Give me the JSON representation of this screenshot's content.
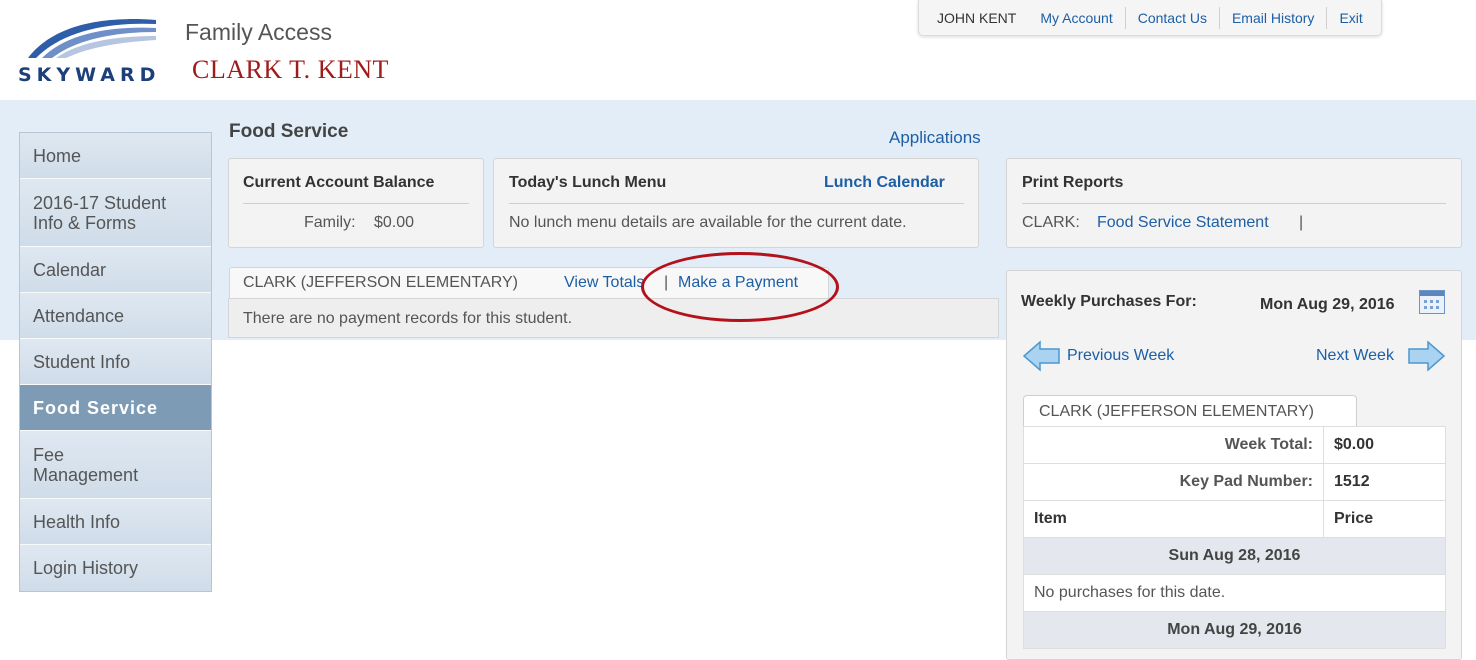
{
  "header": {
    "logo_text": "SKYWARD",
    "product": "Family Access",
    "student_name": "CLARK T. KENT"
  },
  "topnav": {
    "user": "JOHN KENT",
    "my_account": "My Account",
    "contact_us": "Contact Us",
    "email_history": "Email History",
    "exit": "Exit"
  },
  "sidebar": {
    "items": [
      {
        "label": "Home"
      },
      {
        "label": "2016-17 Student Info & Forms"
      },
      {
        "label": "Calendar"
      },
      {
        "label": "Attendance"
      },
      {
        "label": "Student Info"
      },
      {
        "label": "Food Service"
      },
      {
        "label": "Fee Management"
      },
      {
        "label": "Health Info"
      },
      {
        "label": "Login History"
      }
    ]
  },
  "main": {
    "title": "Food Service",
    "applications_link": "Applications",
    "balance": {
      "title": "Current Account Balance",
      "family_label": "Family:",
      "family_value": "$0.00"
    },
    "lunch": {
      "title": "Today's Lunch Menu",
      "calendar_link": "Lunch Calendar",
      "message": "No lunch menu details are available for the current date."
    },
    "reports": {
      "title": "Print Reports",
      "student": "CLARK:",
      "statement_link": "Food Service Statement",
      "separator": "|"
    },
    "student_tab": {
      "label": "CLARK (JEFFERSON ELEMENTARY)",
      "view_totals": "View Totals",
      "separator": "|",
      "make_payment": "Make a Payment",
      "message": "There are no payment records for this student."
    }
  },
  "weekly": {
    "label": "Weekly Purchases For:",
    "date": "Mon Aug 29, 2016",
    "prev": "Previous Week",
    "next": "Next Week",
    "tab": "CLARK (JEFFERSON ELEMENTARY)",
    "week_total_label": "Week Total:",
    "week_total_value": "$0.00",
    "keypad_label": "Key Pad Number:",
    "keypad_value": "1512",
    "col_item": "Item",
    "col_price": "Price",
    "day1": "Sun Aug 28, 2016",
    "day1_msg": "No purchases for this date.",
    "day2": "Mon Aug 29, 2016"
  },
  "colors": {
    "link": "#1d5ea5",
    "student_name": "#a01b1b",
    "active_nav": "#7e9bb6",
    "highlight": "#b3121b"
  }
}
